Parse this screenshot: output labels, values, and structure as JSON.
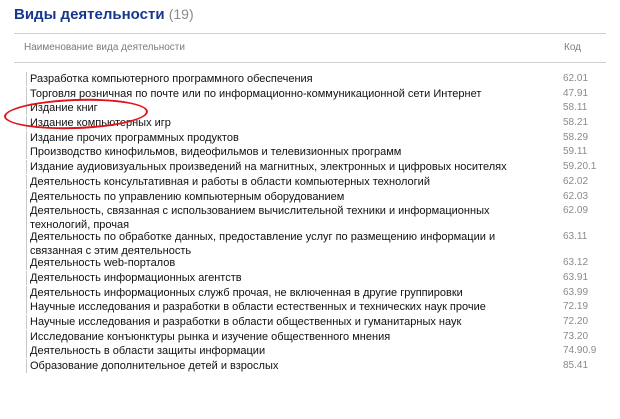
{
  "title": "Виды деятельности",
  "count": "(19)",
  "columns": {
    "name": "Наименование вида деятельности",
    "code": "Код"
  },
  "rows": [
    {
      "name": "Разработка компьютерного программного обеспечения",
      "code": "62.01"
    },
    {
      "name": "Торговля розничная по почте или по информационно-коммуникационной сети Интернет",
      "code": "47.91"
    },
    {
      "name": "Издание книг",
      "code": "58.11"
    },
    {
      "name": "Издание компьютерных игр",
      "code": "58.21"
    },
    {
      "name": "Издание прочих программных продуктов",
      "code": "58.29"
    },
    {
      "name": "Производство кинофильмов, видеофильмов и телевизионных программ",
      "code": "59.11"
    },
    {
      "name": "Издание аудиовизуальных произведений на магнитных, электронных и цифровых носителях",
      "code": "59.20.1"
    },
    {
      "name": "Деятельность консультативная и работы в области компьютерных технологий",
      "code": "62.02"
    },
    {
      "name": "Деятельность по управлению компьютерным оборудованием",
      "code": "62.03"
    },
    {
      "name": "Деятельность, связанная с использованием вычислительной техники и информационных технологий, прочая",
      "code": "62.09"
    },
    {
      "name": "Деятельность по обработке данных, предоставление услуг по размещению информации и связанная с этим деятельность",
      "code": "63.11"
    },
    {
      "name": "Деятельность web-порталов",
      "code": "63.12"
    },
    {
      "name": "Деятельность информационных агентств",
      "code": "63.91"
    },
    {
      "name": "Деятельность информационных служб прочая, не включенная в другие группировки",
      "code": "63.99"
    },
    {
      "name": "Научные исследования и разработки в области естественных и технических наук прочие",
      "code": "72.19"
    },
    {
      "name": "Научные исследования и разработки в области общественных и гуманитарных наук",
      "code": "72.20"
    },
    {
      "name": "Исследование конъюнктуры рынка и изучение общественного мнения",
      "code": "73.20"
    },
    {
      "name": "Деятельность в области защиты информации",
      "code": "74.90.9"
    },
    {
      "name": "Образование дополнительное детей и взрослых",
      "code": "85.41"
    }
  ]
}
